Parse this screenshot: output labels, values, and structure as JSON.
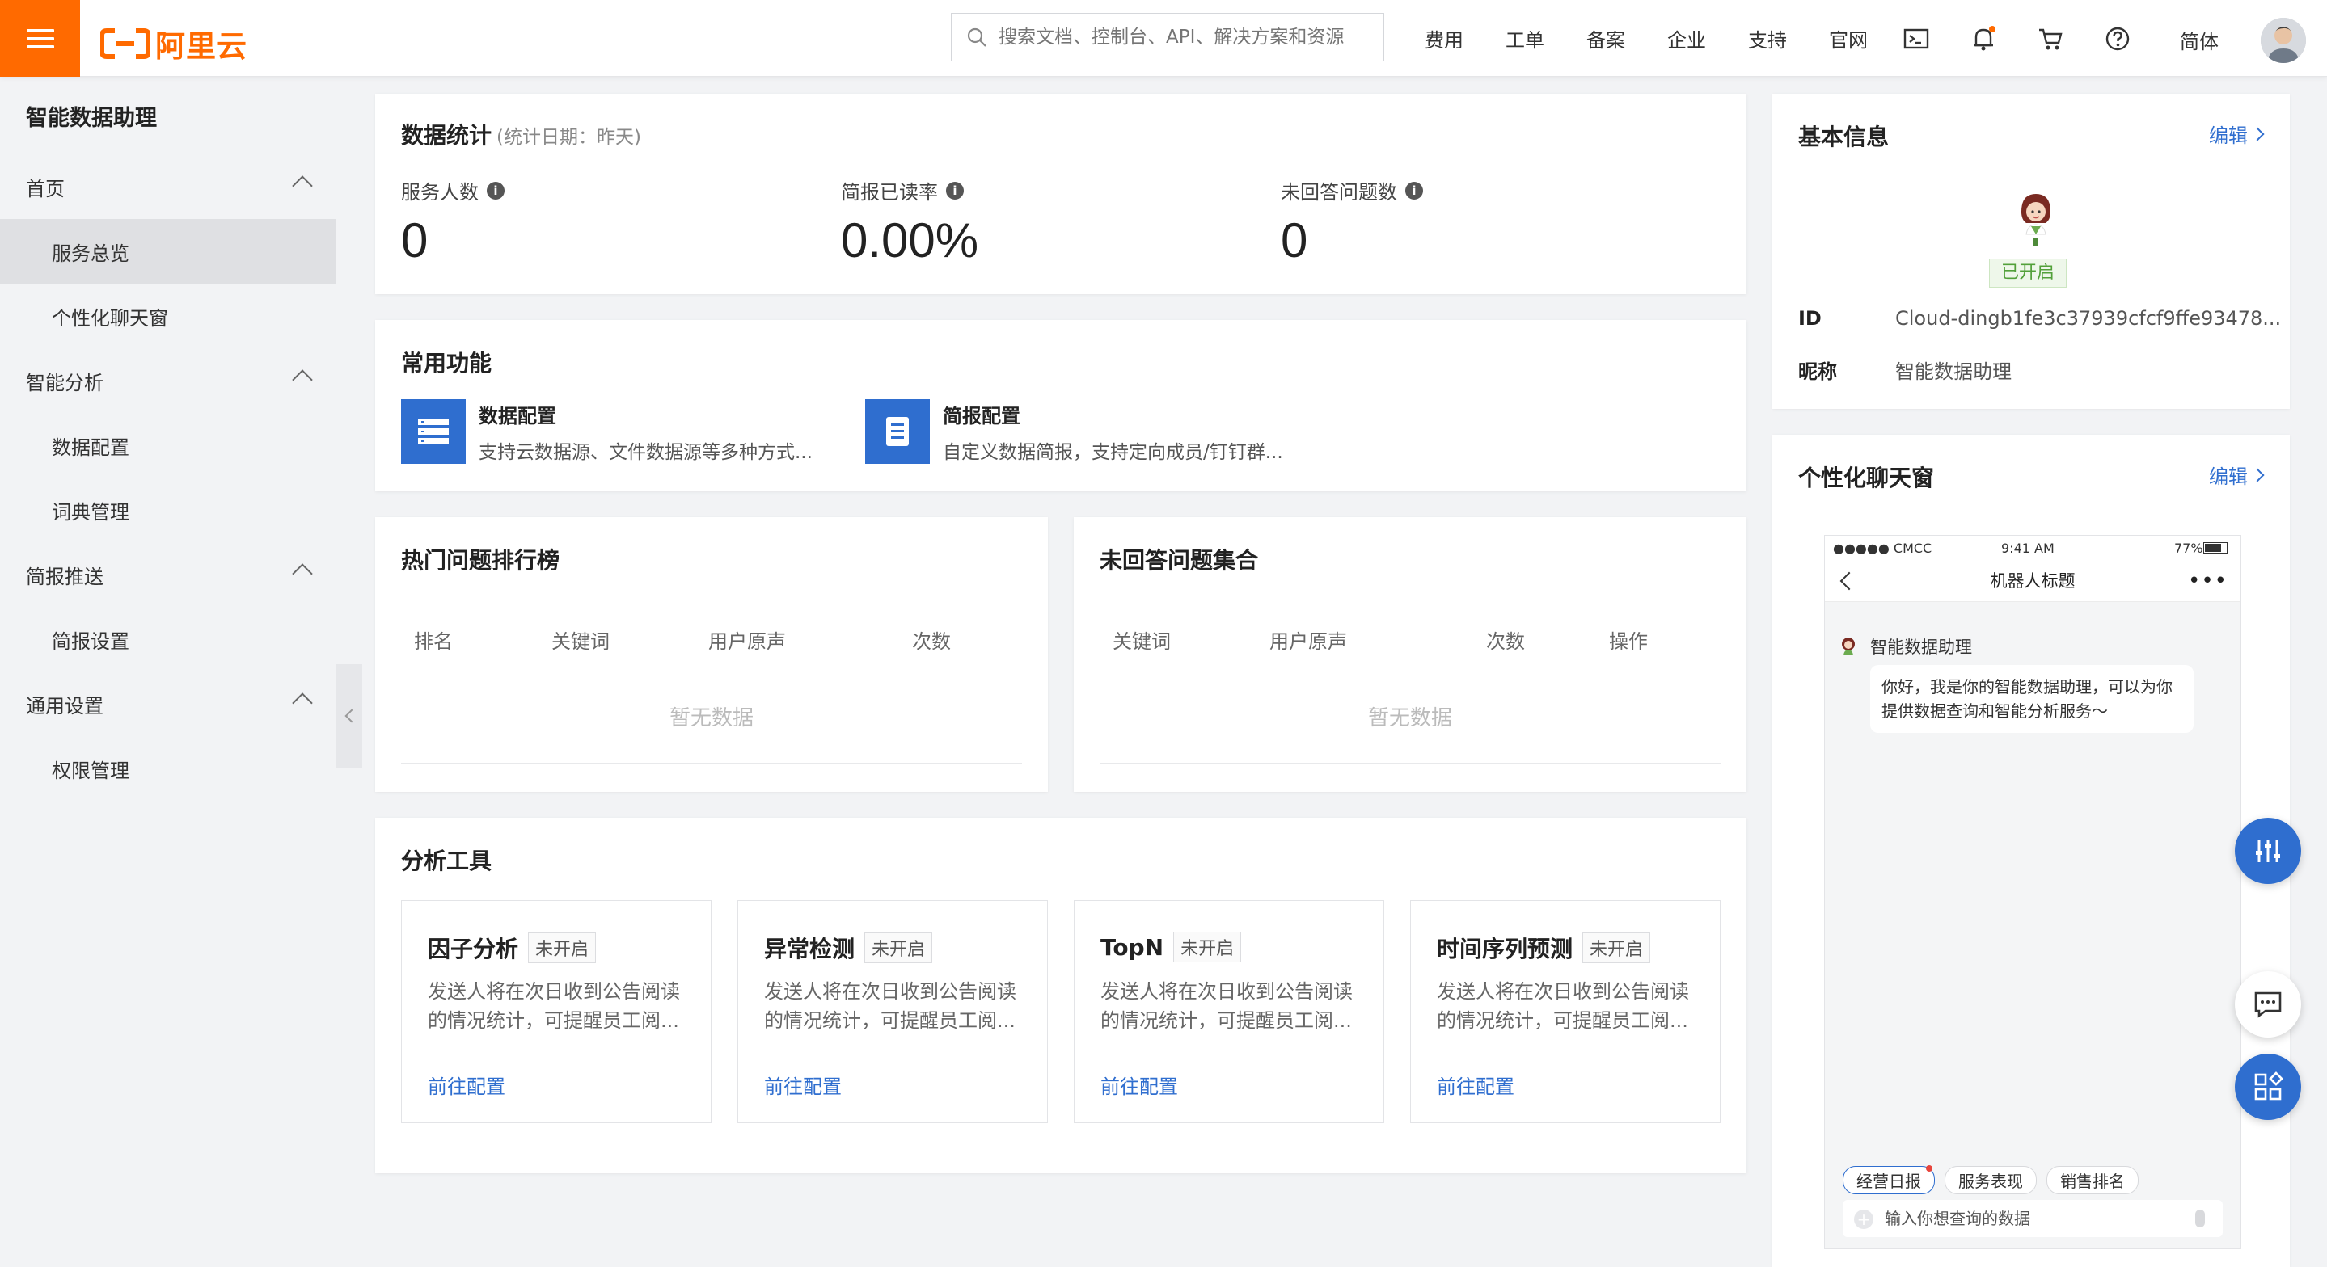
{
  "brand": {
    "name": "阿里云",
    "color": "#ff6a00",
    "accent": "#2f6ecf"
  },
  "header": {
    "search_placeholder": "搜索文档、控制台、API、解决方案和资源",
    "nav": [
      "费用",
      "工单",
      "备案",
      "企业",
      "支持",
      "官网"
    ],
    "icons": [
      "terminal-icon",
      "bell-icon",
      "cart-icon",
      "help-icon"
    ],
    "lang": "简体"
  },
  "sidebar": {
    "title": "智能数据助理",
    "groups": [
      {
        "label": "首页",
        "items": [
          "服务总览",
          "个性化聊天窗"
        ]
      },
      {
        "label": "智能分析",
        "items": [
          "数据配置",
          "词典管理"
        ]
      },
      {
        "label": "简报推送",
        "items": [
          "简报设置"
        ]
      },
      {
        "label": "通用设置",
        "items": [
          "权限管理"
        ]
      }
    ],
    "active_item": "服务总览"
  },
  "stats": {
    "title": "数据统计",
    "subtitle": "(统计日期：昨天)",
    "items": [
      {
        "label": "服务人数",
        "value": "0"
      },
      {
        "label": "简报已读率",
        "value": "0.00%"
      },
      {
        "label": "未回答问题数",
        "value": "0"
      }
    ]
  },
  "functions": {
    "title": "常用功能",
    "items": [
      {
        "name": "数据配置",
        "desc": "支持云数据源、文件数据源等多种方式..."
      },
      {
        "name": "简报配置",
        "desc": "自定义数据简报，支持定向成员/钉钉群..."
      }
    ]
  },
  "hot": {
    "title": "热门问题排行榜",
    "columns": [
      "排名",
      "关键词",
      "用户原声",
      "次数"
    ],
    "empty": "暂无数据"
  },
  "unanswered": {
    "title": "未回答问题集合",
    "columns": [
      "关键词",
      "用户原声",
      "次数",
      "操作"
    ],
    "empty": "暂无数据"
  },
  "tools": {
    "title": "分析工具",
    "items": [
      {
        "name": "因子分析",
        "status": "未开启",
        "desc": "发送人将在次日收到公告阅读的情况统计，可提醒员工阅...",
        "link": "前往配置"
      },
      {
        "name": "异常检测",
        "status": "未开启",
        "desc": "发送人将在次日收到公告阅读的情况统计，可提醒员工阅...",
        "link": "前往配置"
      },
      {
        "name": "TopN",
        "status": "未开启",
        "desc": "发送人将在次日收到公告阅读的情况统计，可提醒员工阅...",
        "link": "前往配置"
      },
      {
        "name": "时间序列预测",
        "status": "未开启",
        "desc": "发送人将在次日收到公告阅读的情况统计，可提醒员工阅...",
        "link": "前往配置"
      }
    ]
  },
  "basic": {
    "title": "基本信息",
    "edit": "编辑",
    "status": "已开启",
    "id_label": "ID",
    "id_value": "Cloud-dingb1fe3c37939cfcf9ffe93478...",
    "nick_label": "昵称",
    "nick_value": "智能数据助理"
  },
  "chatwin": {
    "title": "个性化聊天窗",
    "edit": "编辑",
    "carrier": "●●●●● CMCC",
    "time": "9:41 AM",
    "battery": "77%",
    "robot_title": "机器人标题",
    "bot_name": "智能数据助理",
    "greeting": "你好，我是你的智能数据助理，可以为你提供数据查询和智能分析服务～",
    "chips": [
      "经营日报",
      "服务表现",
      "销售排名"
    ],
    "input_placeholder": "输入你想查询的数据"
  }
}
